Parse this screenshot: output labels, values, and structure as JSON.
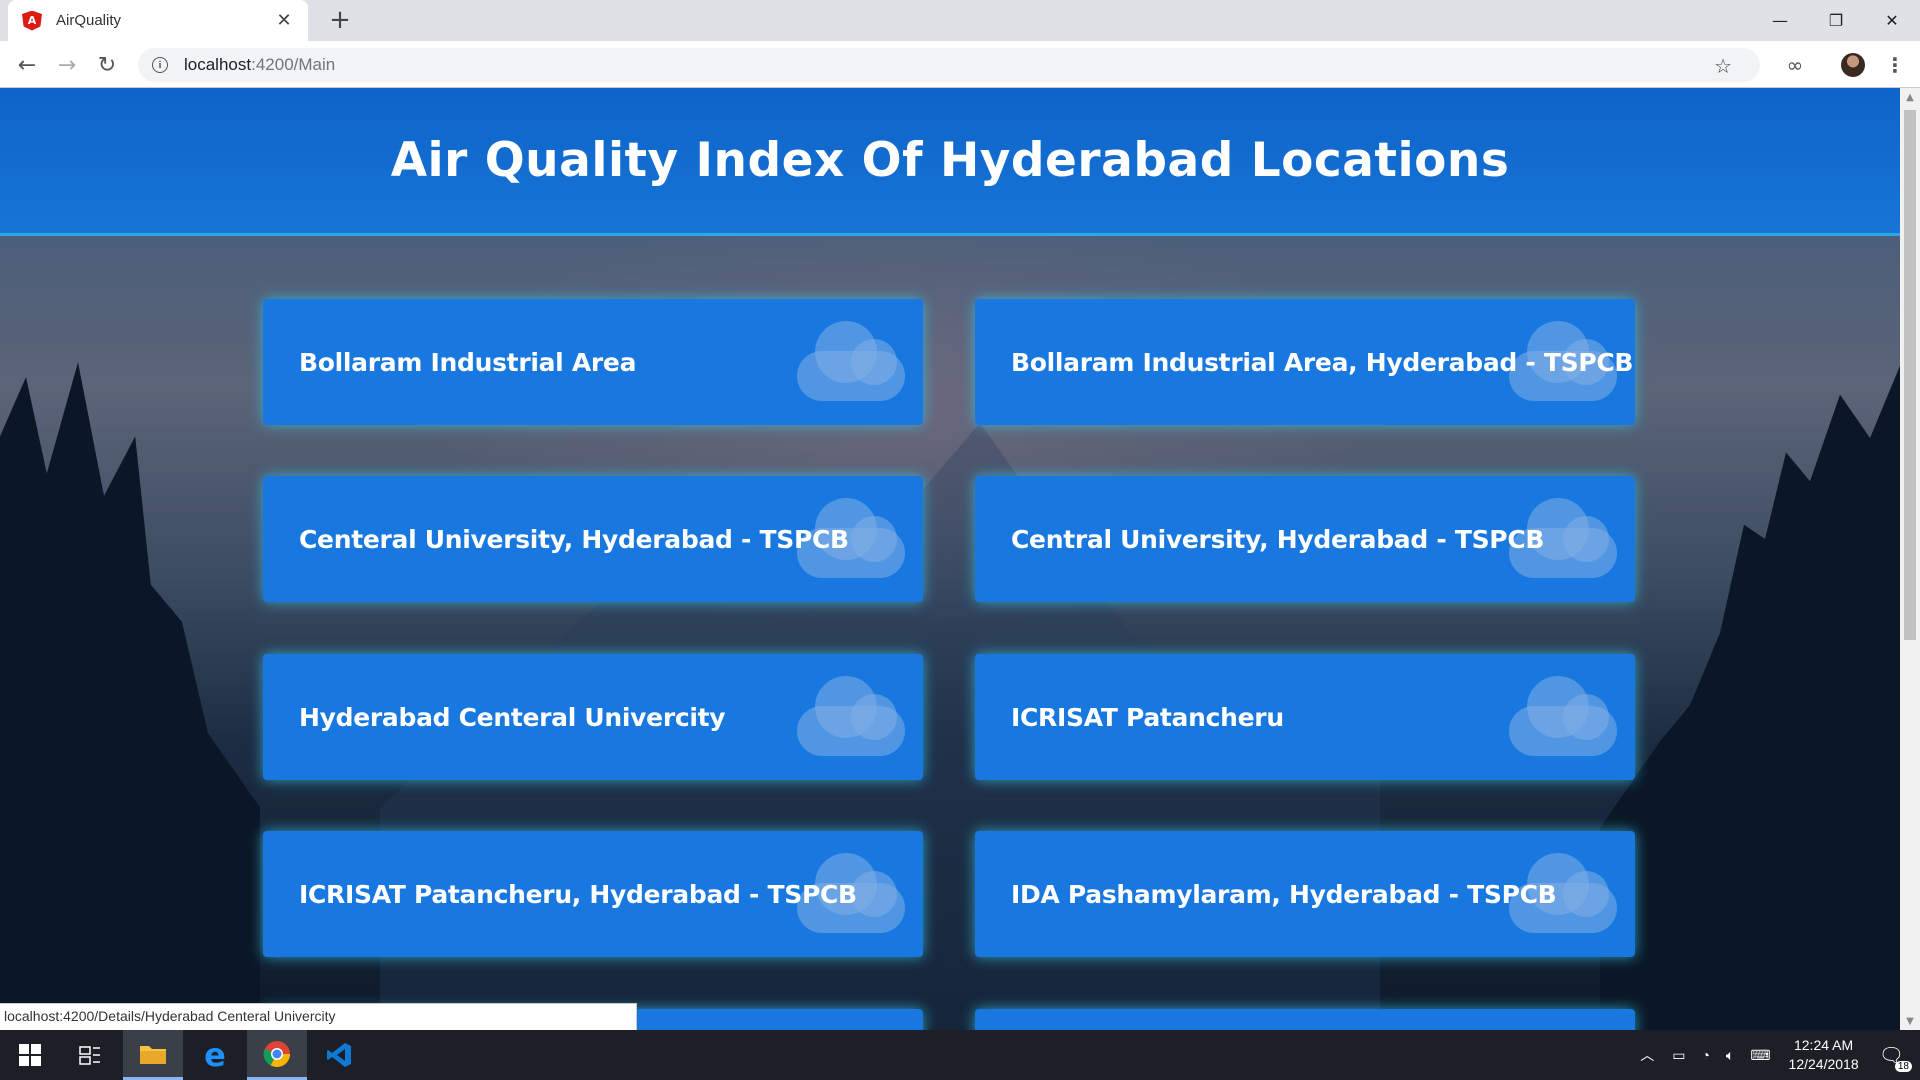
{
  "browser": {
    "tab_title": "AirQuality",
    "url_host": "localhost",
    "url_path": ":4200/Main"
  },
  "page": {
    "title": "Air Quality Index Of Hyderabad Locations",
    "locations": [
      "Bollaram Industrial Area",
      "Bollaram Industrial Area, Hyderabad - TSPCB",
      "Centeral University, Hyderabad - TSPCB",
      "Central University, Hyderabad - TSPCB",
      "Hyderabad Centeral Univercity",
      "ICRISAT Patancheru",
      "ICRISAT Patancheru, Hyderabad - TSPCB",
      "IDA Pashamylaram, Hyderabad - TSPCB"
    ]
  },
  "status_bar": "localhost:4200/Details/Hyderabad Centeral Univercity",
  "taskbar": {
    "time": "12:24 AM",
    "date": "12/24/2018",
    "notification_count": "18"
  },
  "colors": {
    "header": "#0e63c9",
    "card": "#1878e0",
    "glow": "#35c4ec"
  }
}
